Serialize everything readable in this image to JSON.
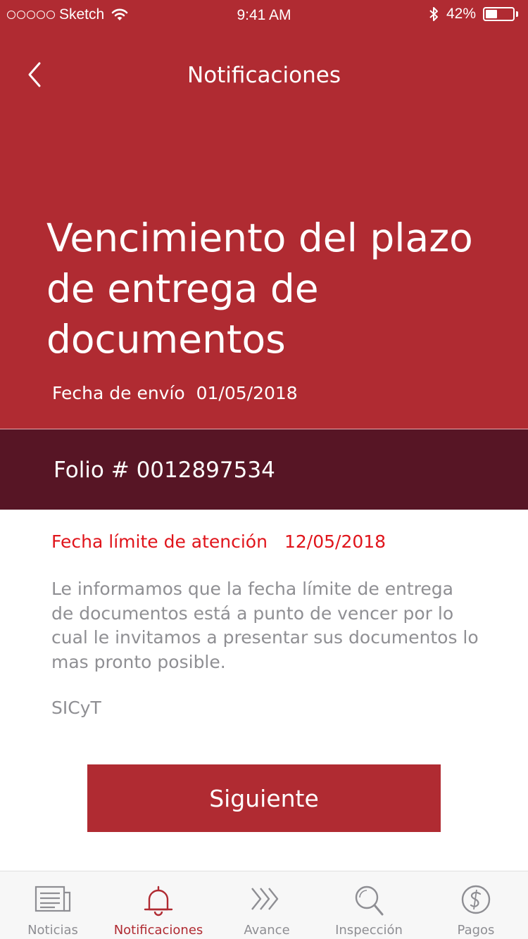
{
  "status_bar": {
    "carrier": "Sketch",
    "time": "9:41 AM",
    "battery_percent": "42%",
    "battery_level": 0.42
  },
  "nav": {
    "title": "Notificaciones",
    "back_icon": "chevron-left-icon"
  },
  "notification": {
    "title": "Vencimiento del plazo de entrega de documentos",
    "sent_label": "Fecha de envío",
    "sent_date": "01/05/2018",
    "folio": "Folio # 0012897534",
    "deadline_label": "Fecha límite de atención",
    "deadline_date": "12/05/2018",
    "message": "Le informamos que la fecha límite de entrega de documentos está a punto de vencer por lo cual le invitamos a presentar sus documentos lo mas pronto posible.",
    "signature": "SICyT"
  },
  "actions": {
    "next_label": "Siguiente"
  },
  "tabbar": {
    "items": [
      {
        "label": "Noticias",
        "icon": "newspaper-icon",
        "active": false
      },
      {
        "label": "Notificaciones",
        "icon": "bell-icon",
        "active": true
      },
      {
        "label": "Avance",
        "icon": "triple-chevron-right-icon",
        "active": false
      },
      {
        "label": "Inspección",
        "icon": "magnifier-icon",
        "active": false
      },
      {
        "label": "Pagos",
        "icon": "dollar-coin-icon",
        "active": false
      }
    ]
  },
  "colors": {
    "primary_red": "#b02b32",
    "folio_bar": "#571525",
    "deadline_red": "#e0141b",
    "body_gray": "#8f8f93",
    "tab_inactive": "#8e8e93",
    "tabbar_bg": "#f7f7f7"
  }
}
